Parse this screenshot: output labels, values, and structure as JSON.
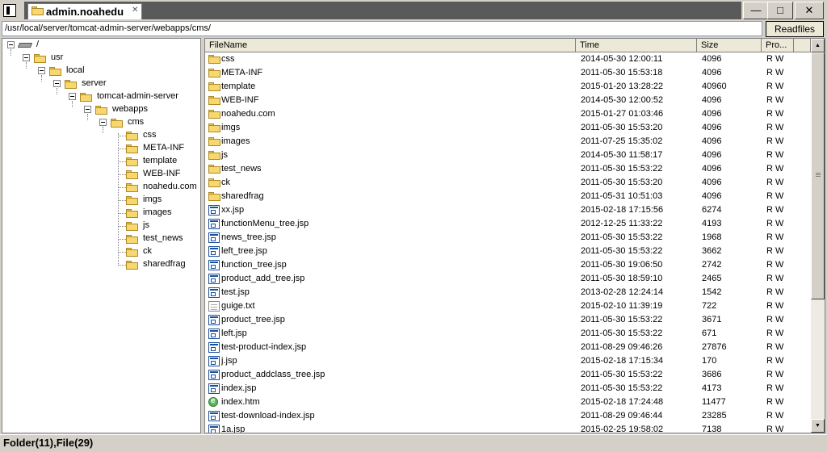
{
  "window": {
    "tab_title": "admin.noahedu.c",
    "tab_close": "✕",
    "minimize": "—",
    "maximize": "□",
    "close": "✕"
  },
  "toolbar": {
    "path": "/usr/local/server/tomcat-admin-server/webapps/cms/",
    "readfiles_label": "Readfiles"
  },
  "tree": {
    "root": "/",
    "usr": "usr",
    "local": "local",
    "server": "server",
    "tomcat": "tomcat-admin-server",
    "webapps": "webapps",
    "cms": "cms",
    "children": [
      "css",
      "META-INF",
      "template",
      "WEB-INF",
      "noahedu.com",
      "imgs",
      "images",
      "js",
      "test_news",
      "ck",
      "sharedfrag"
    ]
  },
  "list": {
    "columns": [
      "FileName",
      "Time",
      "Size",
      "Pro..."
    ],
    "rows": [
      {
        "type": "folder",
        "name": "css",
        "time": "2014-05-30 12:00:11",
        "size": "4096",
        "perm": "R W"
      },
      {
        "type": "folder",
        "name": "META-INF",
        "time": "2011-05-30 15:53:18",
        "size": "4096",
        "perm": "R W"
      },
      {
        "type": "folder",
        "name": "template",
        "time": "2015-01-20 13:28:22",
        "size": "40960",
        "perm": "R W"
      },
      {
        "type": "folder",
        "name": "WEB-INF",
        "time": "2014-05-30 12:00:52",
        "size": "4096",
        "perm": "R W"
      },
      {
        "type": "folder",
        "name": "noahedu.com",
        "time": "2015-01-27 01:03:46",
        "size": "4096",
        "perm": "R W"
      },
      {
        "type": "folder",
        "name": "imgs",
        "time": "2011-05-30 15:53:20",
        "size": "4096",
        "perm": "R W"
      },
      {
        "type": "folder",
        "name": "images",
        "time": "2011-07-25 15:35:02",
        "size": "4096",
        "perm": "R W"
      },
      {
        "type": "folder",
        "name": "js",
        "time": "2014-05-30 11:58:17",
        "size": "4096",
        "perm": "R W"
      },
      {
        "type": "folder",
        "name": "test_news",
        "time": "2011-05-30 15:53:22",
        "size": "4096",
        "perm": "R W"
      },
      {
        "type": "folder",
        "name": "ck",
        "time": "2011-05-30 15:53:20",
        "size": "4096",
        "perm": "R W"
      },
      {
        "type": "folder",
        "name": "sharedfrag",
        "time": "2011-05-31 10:51:03",
        "size": "4096",
        "perm": "R W"
      },
      {
        "type": "jsp",
        "name": "xx.jsp",
        "time": "2015-02-18 17:15:56",
        "size": "6274",
        "perm": "R W"
      },
      {
        "type": "jsp",
        "name": "functionMenu_tree.jsp",
        "time": "2012-12-25 11:33:22",
        "size": "4193",
        "perm": "R W"
      },
      {
        "type": "jsp",
        "name": "news_tree.jsp",
        "time": "2011-05-30 15:53:22",
        "size": "1968",
        "perm": "R W"
      },
      {
        "type": "jsp",
        "name": "left_tree.jsp",
        "time": "2011-05-30 15:53:22",
        "size": "3662",
        "perm": "R W"
      },
      {
        "type": "jsp",
        "name": "function_tree.jsp",
        "time": "2011-05-30 19:06:50",
        "size": "2742",
        "perm": "R W"
      },
      {
        "type": "jsp",
        "name": "product_add_tree.jsp",
        "time": "2011-05-30 18:59:10",
        "size": "2465",
        "perm": "R W"
      },
      {
        "type": "jsp",
        "name": "test.jsp",
        "time": "2013-02-28 12:24:14",
        "size": "1542",
        "perm": "R W"
      },
      {
        "type": "txt",
        "name": "guige.txt",
        "time": "2015-02-10 11:39:19",
        "size": "722",
        "perm": "R W"
      },
      {
        "type": "jsp",
        "name": "product_tree.jsp",
        "time": "2011-05-30 15:53:22",
        "size": "3671",
        "perm": "R W"
      },
      {
        "type": "jsp",
        "name": "left.jsp",
        "time": "2011-05-30 15:53:22",
        "size": "671",
        "perm": "R W"
      },
      {
        "type": "jsp",
        "name": "test-product-index.jsp",
        "time": "2011-08-29 09:46:26",
        "size": "27876",
        "perm": "R W"
      },
      {
        "type": "jsp",
        "name": "j.jsp",
        "time": "2015-02-18 17:15:34",
        "size": "170",
        "perm": "R W"
      },
      {
        "type": "jsp",
        "name": "product_addclass_tree.jsp",
        "time": "2011-05-30 15:53:22",
        "size": "3686",
        "perm": "R W"
      },
      {
        "type": "jsp",
        "name": "index.jsp",
        "time": "2011-05-30 15:53:22",
        "size": "4173",
        "perm": "R W"
      },
      {
        "type": "htm",
        "name": "index.htm",
        "time": "2015-02-18 17:24:48",
        "size": "11477",
        "perm": "R W"
      },
      {
        "type": "jsp",
        "name": "test-download-index.jsp",
        "time": "2011-08-29 09:46:44",
        "size": "23285",
        "perm": "R W"
      },
      {
        "type": "jsp",
        "name": "1a.jsp",
        "time": "2015-02-25 19:58:02",
        "size": "7138",
        "perm": "R W"
      }
    ]
  },
  "scrollbar": {
    "up": "▲",
    "down": "▼"
  },
  "status": {
    "text": "Folder(11),File(29)"
  }
}
